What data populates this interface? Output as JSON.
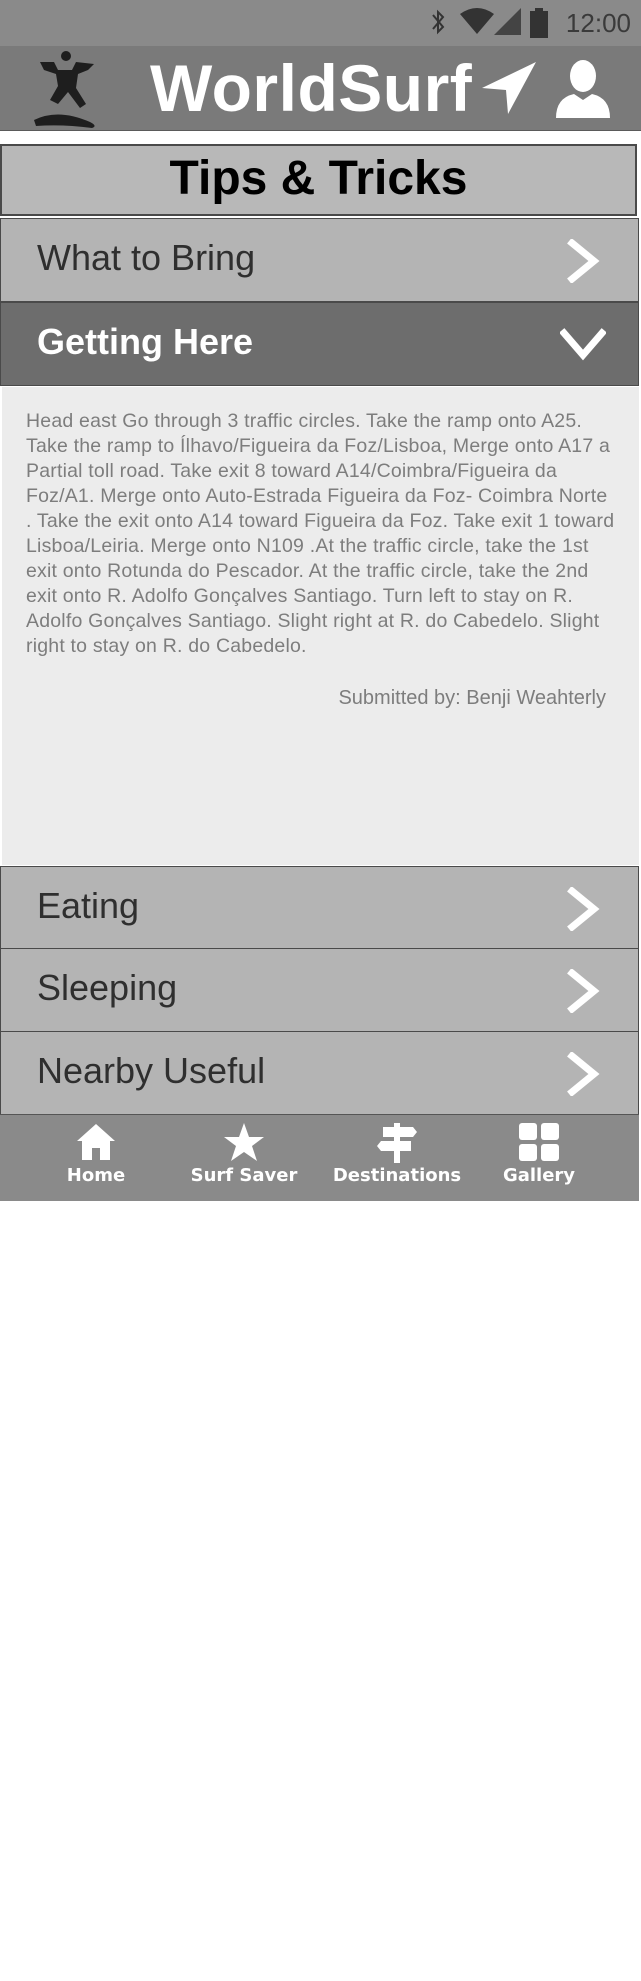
{
  "status_bar": {
    "time": "12:00",
    "icons": [
      "bluetooth-icon",
      "wifi-icon",
      "signal-icon",
      "battery-icon"
    ]
  },
  "header": {
    "title": "WorldSurf",
    "logo": "surfer-logo-icon",
    "right_icons": [
      "navigation-arrow-icon",
      "user-profile-icon"
    ]
  },
  "section": {
    "title": "Tips & Tricks"
  },
  "accordion": {
    "items": [
      {
        "label": "What to Bring",
        "state": "collapsed"
      },
      {
        "label": "Getting Here",
        "state": "expanded"
      },
      {
        "label": "Eating",
        "state": "collapsed"
      },
      {
        "label": "Sleeping",
        "state": "collapsed"
      },
      {
        "label": "Nearby Useful",
        "state": "collapsed"
      }
    ],
    "expanded_content": {
      "text": "Head east Go through 3 traffic circles. Take the ramp onto A25. Take the ramp to Ílhavo/Figueira da Foz/Lisboa, Merge onto A17 a Partial toll road. Take exit 8 toward A14/Coimbra/Figueira da Foz/A1. Merge onto Auto-Estrada Figueira da Foz- Coimbra Norte . Take the exit onto A14 toward Figueira da Foz. Take exit 1 toward Lisboa/Leiria. Merge onto N109 .At the traffic circle, take the 1st exit onto Rotunda do Pescador. At the traffic circle, take the 2nd exit onto R. Adolfo Gonçalves Santiago. Turn left to stay on R. Adolfo Gonçalves Santiago. Slight right at R. do Cabedelo. Slight right to stay on R. do Cabedelo.",
      "submitted_by": "Submitted by: Benji Weahterly"
    }
  },
  "tab_bar": {
    "tabs": [
      {
        "label": "Home",
        "icon": "home-icon"
      },
      {
        "label": "Surf Saver",
        "icon": "star-icon"
      },
      {
        "label": "Destinations",
        "icon": "signpost-icon"
      },
      {
        "label": "Gallery",
        "icon": "grid-icon"
      }
    ]
  },
  "colors": {
    "header_bg": "#7a7a7a",
    "row_bg": "#b4b4b4",
    "row_expanded_bg": "#6d6d6d",
    "panel_bg": "#ececec",
    "tabbar_bg": "#8a8a8a"
  }
}
